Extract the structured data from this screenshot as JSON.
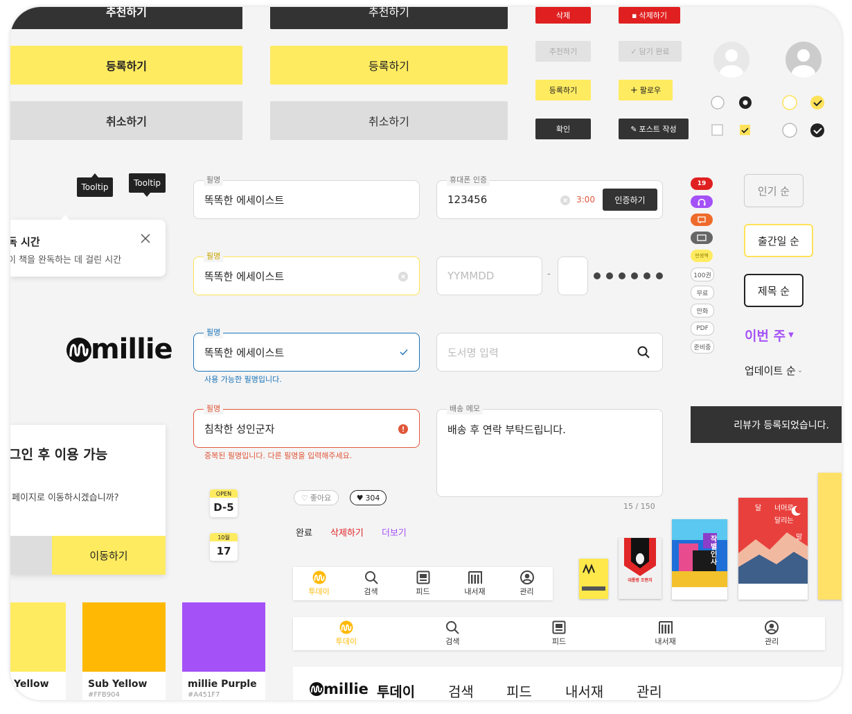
{
  "buttons": {
    "recommend": "추천하기",
    "register": "등록하기",
    "cancel": "취소하기"
  },
  "small_buttons": {
    "delete": "삭제",
    "delete_icon": "삭제하기",
    "recommend": "추천하기",
    "saved": "담기 완료",
    "register": "등록하기",
    "follow": "팔로우",
    "confirm": "확인",
    "write_post": "포스트 작성"
  },
  "tooltips": {
    "a": "Tooltip",
    "b": "Tooltip"
  },
  "info_popup": {
    "title": "독 시간",
    "desc": "이 책을 완독하는 데 걸린 시간"
  },
  "logo": "millie",
  "fields": {
    "nickname_label": "필명",
    "f1_value": "똑똑한 에세이스트",
    "f2_value": "똑똑한 에세이스트",
    "f3_value": "똑똑한 에세이스트",
    "f3_help": "사용 가능한 필명입니다.",
    "f4_value": "침착한 성인군자",
    "f4_error": "중복된 필명입니다. 다른 필명을 입력해주세요.",
    "phone_label": "휴대폰 인증",
    "phone_value": "123456",
    "phone_timer": "3:00",
    "phone_button": "인증하기",
    "birth_placeholder": "YYMMDD",
    "birth_dash": "-",
    "book_search_placeholder": "도서명 입력",
    "memo_label": "배송 메모",
    "memo_value": "배송 후 연락 부탁드립니다.",
    "memo_count": "15 / 150"
  },
  "login_modal": {
    "title": "그인 후 이용 가능",
    "desc": "페이지로 이동하시겠습니까?",
    "go": "이동하기"
  },
  "date_badges": {
    "open": "OPEN",
    "dday": "D-5",
    "month": "10월",
    "day": "17"
  },
  "like_chips": {
    "like": "좋아요",
    "count": "304"
  },
  "text_links": {
    "done": "완료",
    "delete": "삭제하기",
    "more": "더보기"
  },
  "tags": {
    "count": "19",
    "student": "만생책",
    "vol": "100권",
    "free": "무료",
    "comic": "만화",
    "pdf": "PDF",
    "preparing": "준비중"
  },
  "sort": {
    "popular": "인기 순",
    "pubdate": "출간일 순",
    "title": "제목 순",
    "this_week": "이번 주",
    "update": "업데이트 순"
  },
  "toast": "리뷰가 등록되었습니다.",
  "bottom_nav": [
    "투데이",
    "검색",
    "피드",
    "내서재",
    "관리"
  ],
  "top_nav": [
    "투데이",
    "검색",
    "피드",
    "내서재",
    "관리"
  ],
  "swatches": [
    {
      "name": "Yellow",
      "hex": ""
    },
    {
      "name": "Sub Yellow",
      "hex": "#FFB904"
    },
    {
      "name": "millie Purple",
      "hex": "#A451F7"
    }
  ],
  "book_covers": {
    "b3": "작별 인사",
    "b2": "대통령 조편지",
    "b4_line1": "달",
    "b4_line2": "너머로",
    "b4_line3": "달리는",
    "b4_line4": "말"
  },
  "colors": {
    "yellow": "#FFEB60",
    "sub_yellow": "#FFB904",
    "purple": "#A451F7",
    "dark": "#333333",
    "red": "#E02020",
    "blue": "#1a73b8"
  }
}
